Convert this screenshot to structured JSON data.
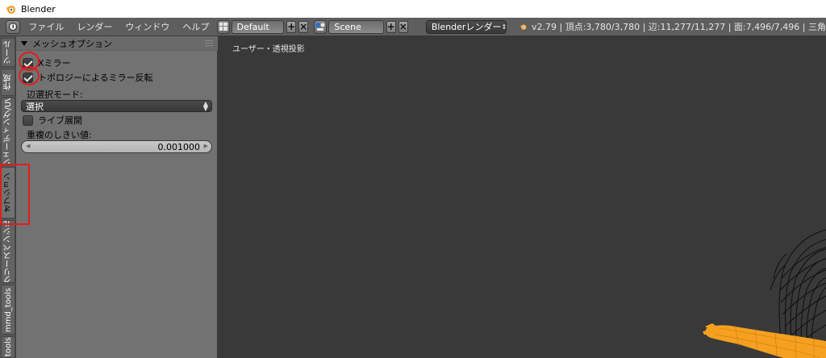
{
  "window": {
    "title": "Blender"
  },
  "header": {
    "menus": [
      "ファイル",
      "レンダー",
      "ウィンドウ",
      "ヘルプ"
    ],
    "layout_name": "Default",
    "scene_name": "Scene",
    "render_engine": "Blenderレンダー",
    "stats": "v2.79 | 頂点:3,780/3,780 | 辺:11,277/11,277 | 面:7,496/7,496 | 三角"
  },
  "tabs": [
    "ツール",
    "作成",
    "シェーディング/UV",
    "オプション",
    "グリースペンシル",
    "mmd_tools",
    "tools"
  ],
  "tabs_active_index": 3,
  "panel": {
    "title": "メッシュオプション",
    "mirror_label": "Xミラー",
    "mirror_checked": true,
    "topology_label": "トポロジーによるミラー反転",
    "topology_checked": true,
    "edge_select_label": "辺選択モード:",
    "edge_select_value": "選択",
    "live_unwrap_label": "ライブ展開",
    "live_unwrap_checked": false,
    "threshold_label": "重複のしきい値:",
    "threshold_value": "0.001000"
  },
  "viewport": {
    "label": "ユーザー・透視投影"
  },
  "colors": {
    "accent_orange": "#f5a020",
    "annotation_red": "#e21c1c",
    "viewport_bg": "#393939",
    "panel_bg": "#727272"
  }
}
